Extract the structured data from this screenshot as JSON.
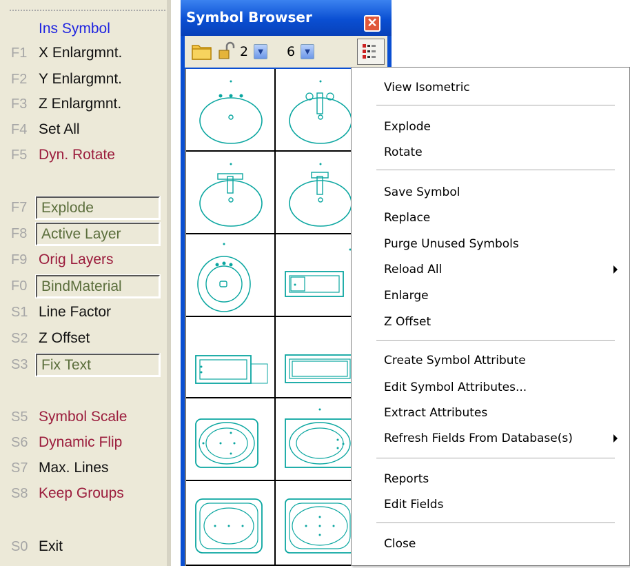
{
  "function_keys": {
    "header": "Ins Symbol",
    "items": [
      {
        "key": "F1",
        "label": "X Enlargmnt.",
        "color": "#111111",
        "boxed": false
      },
      {
        "key": "F2",
        "label": "Y Enlargmnt.",
        "color": "#111111",
        "boxed": false
      },
      {
        "key": "F3",
        "label": "Z Enlargmnt.",
        "color": "#111111",
        "boxed": false
      },
      {
        "key": "F4",
        "label": "Set All",
        "color": "#111111",
        "boxed": false
      },
      {
        "key": "F5",
        "label": "Dyn. Rotate",
        "color": "#9b1c3c",
        "boxed": false
      },
      {
        "key": "F7",
        "label": "Explode",
        "color": "#5b6e3c",
        "boxed": true
      },
      {
        "key": "F8",
        "label": "Active Layer",
        "color": "#5b6e3c",
        "boxed": true
      },
      {
        "key": "F9",
        "label": "Orig  Layers",
        "color": "#9b1c3c",
        "boxed": false
      },
      {
        "key": "F0",
        "label": "BindMaterial",
        "color": "#5b6e3c",
        "boxed": true
      },
      {
        "key": "S1",
        "label": "Line Factor",
        "color": "#111111",
        "boxed": false
      },
      {
        "key": "S2",
        "label": "Z Offset",
        "color": "#111111",
        "boxed": false
      },
      {
        "key": "S3",
        "label": "Fix Text",
        "color": "#5b6e3c",
        "boxed": true
      },
      {
        "key": "S5",
        "label": "Symbol Scale",
        "color": "#9b1c3c",
        "boxed": false
      },
      {
        "key": "S6",
        "label": "Dynamic Flip",
        "color": "#9b1c3c",
        "boxed": false
      },
      {
        "key": "S7",
        "label": "Max. Lines",
        "color": "#111111",
        "boxed": false
      },
      {
        "key": "S8",
        "label": "Keep Groups",
        "color": "#9b1c3c",
        "boxed": false
      },
      {
        "key": "S0",
        "label": "Exit",
        "color": "#111111",
        "boxed": false
      }
    ]
  },
  "browser": {
    "title": "Symbol Browser",
    "close_icon": "close-icon",
    "toolbar": {
      "folder_icon": "folder-icon",
      "lock_icon": "unlock-icon",
      "columns_value": "2",
      "rows_value": "6",
      "list_icon": "list-options-icon"
    },
    "symbols": [
      "sink-oval-three-holes",
      "sink-oval-single-tap",
      "sink-oval-double-tap",
      "sink-oval-lever-tap",
      "sink-round",
      "bathtub-rectangular",
      "bathtub-small",
      "bathtub-framed",
      "bathtub-oval",
      "bathtub-oval-inner",
      "bathtub-oval-double",
      "bathtub-oval-deep"
    ]
  },
  "context_menu": {
    "groups": [
      [
        {
          "label": "View Isometric",
          "submenu": false
        }
      ],
      [
        {
          "label": "Explode",
          "submenu": false
        },
        {
          "label": "Rotate",
          "submenu": false
        }
      ],
      [
        {
          "label": "Save Symbol",
          "submenu": false
        },
        {
          "label": "Replace",
          "submenu": false
        },
        {
          "label": "Purge Unused Symbols",
          "submenu": false
        },
        {
          "label": "Reload All",
          "submenu": true
        },
        {
          "label": "Enlarge",
          "submenu": false
        },
        {
          "label": "Z Offset",
          "submenu": false
        }
      ],
      [
        {
          "label": "Create Symbol Attribute",
          "submenu": false
        },
        {
          "label": "Edit Symbol Attributes...",
          "submenu": false
        },
        {
          "label": "Extract Attributes",
          "submenu": false
        },
        {
          "label": "Refresh Fields From Database(s)",
          "submenu": true
        }
      ],
      [
        {
          "label": "Reports",
          "submenu": false
        },
        {
          "label": "Edit Fields",
          "submenu": false
        }
      ],
      [
        {
          "label": "Close",
          "submenu": false
        }
      ]
    ]
  },
  "colors": {
    "panel_bg": "#ece9d8",
    "title_blue": "#0a4fd2",
    "symbol_cyan": "#0aa6a0",
    "key_gray": "#a6a6a6"
  }
}
